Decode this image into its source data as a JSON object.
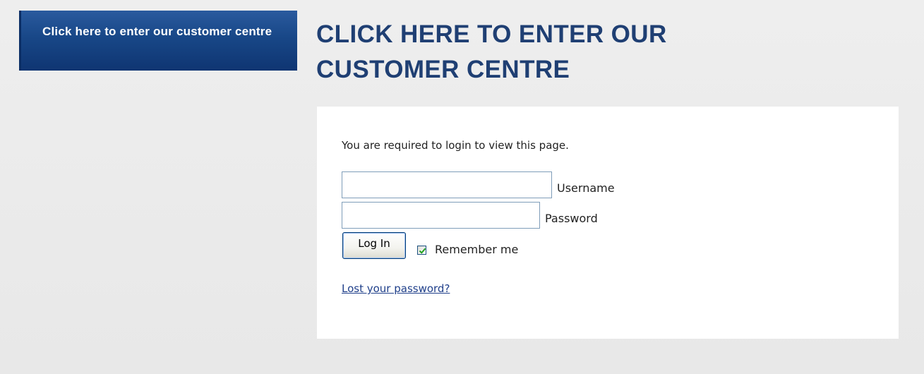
{
  "nav_button": {
    "label": "Click here to enter our customer centre"
  },
  "page_title": "CLICK HERE TO ENTER OUR CUSTOMER CENTRE",
  "login": {
    "notice": "You are required to login to view this page.",
    "username_label": "Username",
    "username_value": "",
    "password_label": "Password",
    "password_value": "",
    "login_button_label": "Log In",
    "remember_label": "Remember me",
    "remember_checked": true,
    "lost_password_link": "Lost your password?"
  },
  "colors": {
    "brand_blue": "#184787",
    "title_blue": "#1f3f73",
    "background": "#e8e8e8",
    "panel": "#ffffff"
  },
  "icons": {
    "checkbox_mark": "check-icon"
  }
}
